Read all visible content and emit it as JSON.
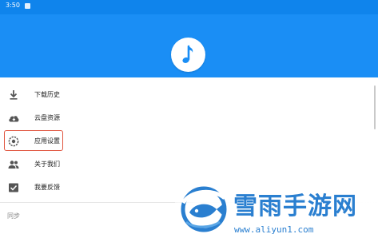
{
  "status_bar": {
    "time": "3:50",
    "color": "#0f84ec"
  },
  "header": {
    "color": "#1a8ef5",
    "logo_icon": "music-note-icon"
  },
  "menu": {
    "items": [
      {
        "label": "下载历史",
        "icon": "download-icon"
      },
      {
        "label": "云盘资源",
        "icon": "cloud-download-icon"
      },
      {
        "label": "应用设置",
        "icon": "settings-icon",
        "highlighted": true
      },
      {
        "label": "关于我们",
        "icon": "people-icon"
      },
      {
        "label": "我要反馈",
        "icon": "feedback-icon"
      }
    ],
    "highlight_color": "#e0553f"
  },
  "section": {
    "label": "同步"
  },
  "watermark": {
    "name": "雪雨手游网",
    "url": "www.aliyun1.com",
    "color": "#2a7fd0"
  }
}
